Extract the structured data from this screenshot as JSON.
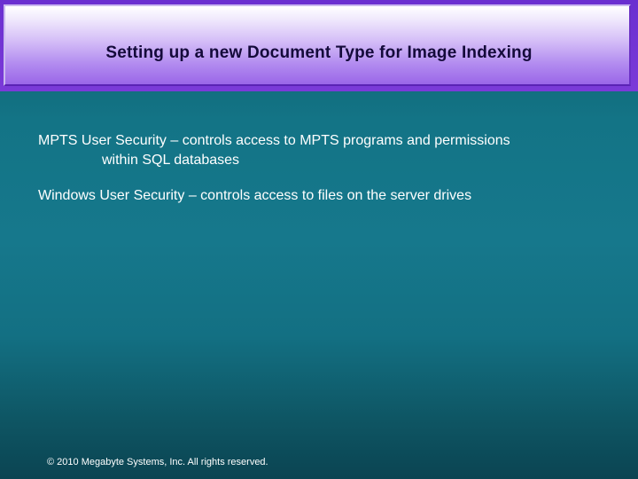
{
  "slide": {
    "title": "Setting up a new Document Type for Image Indexing",
    "bullets": [
      {
        "line1": "MPTS User Security – controls access to MPTS programs and permissions",
        "line2": "within SQL databases"
      },
      {
        "line1": "Windows User Security – controls access to files on the server drives"
      }
    ],
    "footer": "© 2010 Megabyte Systems, Inc. All rights reserved."
  },
  "colors": {
    "header_purple": "#7b3ad8",
    "background_teal": "#16788c",
    "title_text": "#140a3a",
    "body_text": "#ffffff"
  }
}
